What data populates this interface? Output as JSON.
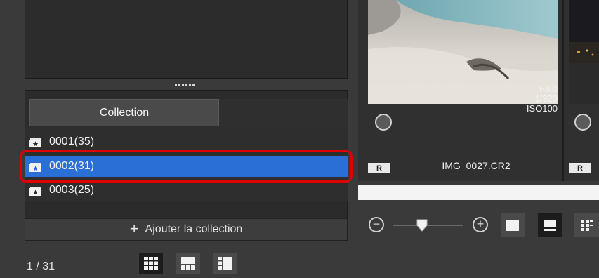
{
  "collection_panel": {
    "tab_label": "Collection",
    "items": [
      {
        "label": "0001(35)",
        "selected": false
      },
      {
        "label": "0002(31)",
        "selected": true
      },
      {
        "label": "0003(25)",
        "selected": false
      }
    ],
    "add_label": "Ajouter la collection"
  },
  "status": {
    "page_indicator": "1 / 31"
  },
  "thumbnail": {
    "aperture": "F8.0",
    "shutter": "1/320",
    "iso": "ISO100",
    "raw_badge": "R",
    "filename": "IMG_0027.CR2"
  },
  "colors": {
    "selection": "#2a6fd6",
    "highlight_outline": "#e00000"
  },
  "icons": {
    "collection": "star-box-icon",
    "add": "plus-icon",
    "zoom_out": "minus-circle-icon",
    "zoom_in": "plus-circle-icon",
    "slider": "slider-thumb-icon",
    "views": [
      "grid-view-icon",
      "preview-list-view-icon",
      "compare-view-icon"
    ],
    "thumb_views": [
      "large-thumbnail-icon",
      "thumbnail-info-icon",
      "small-thumbnail-icon"
    ]
  }
}
